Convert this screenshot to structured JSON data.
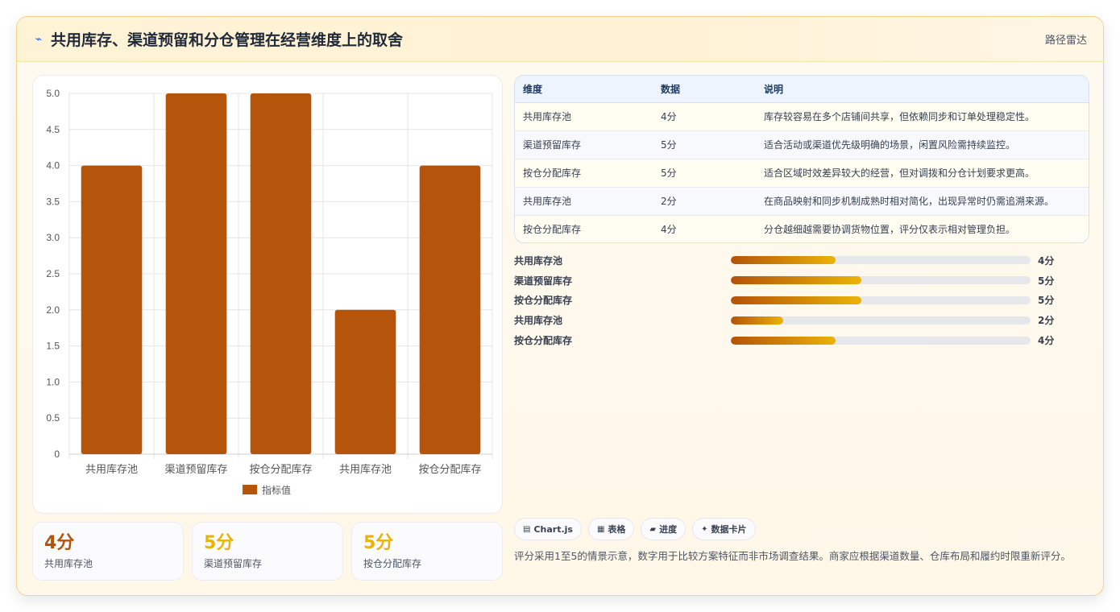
{
  "header": {
    "icon": "bolt-icon",
    "title": "共用库存、渠道预留和分仓管理在经营维度上的取舍",
    "route_label": "路径雷达"
  },
  "colors": {
    "bar": "#b5550b",
    "gradient_start": "#b45309",
    "gradient_end": "#eab308",
    "kpi_primary": "#b45309",
    "kpi_secondary": "#eab308"
  },
  "chart_data": {
    "type": "bar",
    "categories": [
      "共用库存池",
      "渠道预留库存",
      "按仓分配库存",
      "共用库存池",
      "按仓分配库存"
    ],
    "series": [
      {
        "name": "指标值",
        "values": [
          4,
          5,
          5,
          2,
          4
        ]
      }
    ],
    "ylim": [
      0,
      5
    ],
    "yticks": [
      "0",
      "0.5",
      "1.0",
      "1.5",
      "2.0",
      "2.5",
      "3.0",
      "3.5",
      "4.0",
      "4.5",
      "5.0"
    ],
    "grid": true,
    "legend_position": "bottom"
  },
  "kpis": [
    {
      "value": "4分",
      "label": "共用库存池"
    },
    {
      "value": "5分",
      "label": "渠道预留库存"
    },
    {
      "value": "5分",
      "label": "按仓分配库存"
    }
  ],
  "table": {
    "headers": [
      "维度",
      "数据",
      "说明"
    ],
    "rows": [
      [
        "共用库存池",
        "4分",
        "库存较容易在多个店铺间共享，但依赖同步和订单处理稳定性。"
      ],
      [
        "渠道预留库存",
        "5分",
        "适合活动或渠道优先级明确的场景，闲置风险需持续监控。"
      ],
      [
        "按仓分配库存",
        "5分",
        "适合区域时效差异较大的经营，但对调拨和分仓计划要求更高。"
      ],
      [
        "共用库存池",
        "2分",
        "在商品映射和同步机制成熟时相对简化，出现异常时仍需追溯来源。"
      ],
      [
        "按仓分配库存",
        "4分",
        "分仓越细越需要协调货物位置，评分仅表示相对管理负担。"
      ]
    ]
  },
  "progress": [
    {
      "label": "共用库存池",
      "value": "4分",
      "fraction": 0.35
    },
    {
      "label": "渠道预留库存",
      "value": "5分",
      "fraction": 0.435
    },
    {
      "label": "按仓分配库存",
      "value": "5分",
      "fraction": 0.435
    },
    {
      "label": "共用库存池",
      "value": "2分",
      "fraction": 0.175
    },
    {
      "label": "按仓分配库存",
      "value": "4分",
      "fraction": 0.35
    }
  ],
  "chips": [
    {
      "icon": "chart-icon",
      "glyph": "▤",
      "label": "Chart.js"
    },
    {
      "icon": "table-icon",
      "glyph": "▦",
      "label": "表格"
    },
    {
      "icon": "progress-icon",
      "glyph": "▰",
      "label": "进度"
    },
    {
      "icon": "card-icon",
      "glyph": "✦",
      "label": "数据卡片"
    }
  ],
  "note": "评分采用1至5的情景示意，数字用于比较方案特征而非市场调查结果。商家应根据渠道数量、仓库布局和履约时限重新评分。"
}
